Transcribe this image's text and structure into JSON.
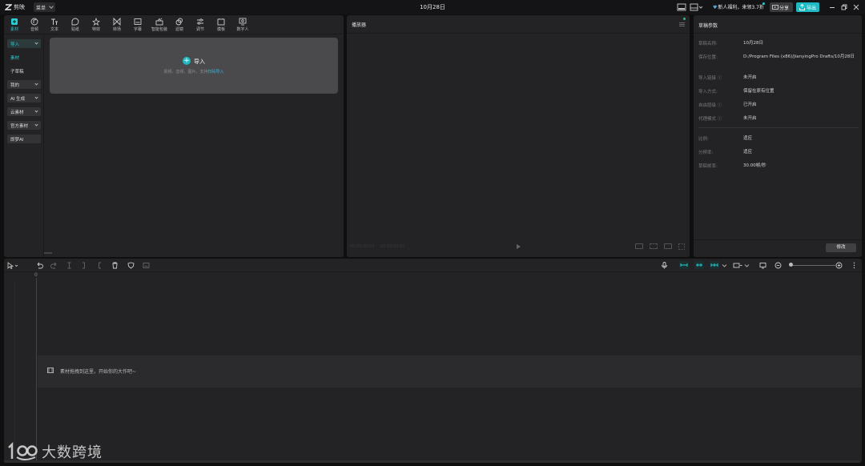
{
  "titlebar": {
    "app_name": "剪映",
    "menu_label": "菜单",
    "project_title": "10月28日",
    "promo": "新人福利，来领3.7折",
    "share_label": "分享",
    "export_label": "导出"
  },
  "media_tabs": [
    {
      "label": "素材",
      "icon": "media-icon"
    },
    {
      "label": "音频",
      "icon": "audio-icon"
    },
    {
      "label": "文本",
      "icon": "text-icon"
    },
    {
      "label": "贴纸",
      "icon": "sticker-icon"
    },
    {
      "label": "特效",
      "icon": "effects-icon"
    },
    {
      "label": "转场",
      "icon": "transition-icon"
    },
    {
      "label": "字幕",
      "icon": "subtitle-icon"
    },
    {
      "label": "智能包装",
      "icon": "smart-package-icon"
    },
    {
      "label": "滤镜",
      "icon": "filter-icon"
    },
    {
      "label": "调节",
      "icon": "adjust-icon"
    },
    {
      "label": "模板",
      "icon": "template-icon"
    },
    {
      "label": "数字人",
      "icon": "digital-human-icon"
    }
  ],
  "media_sidebar": {
    "import": "导入",
    "material": "素材",
    "subproject": "子草稿",
    "mine": "我的",
    "ai_generate": "AI 生成",
    "cloud": "云素材",
    "official": "官方素材",
    "jimeng": "即梦AI"
  },
  "import_area": {
    "label": "导入",
    "hint_prefix": "视频、音频、图片，支持",
    "hint_link": "扫码导入"
  },
  "player": {
    "title": "播放器",
    "time_current": "00:00:00:00",
    "time_total": "00:00:00:00"
  },
  "params": {
    "title": "草稿参数",
    "rows_top": [
      {
        "key": "草稿名称:",
        "value": "10月28日"
      },
      {
        "key": "保存位置:",
        "value": "D:/Program Files (x86)/JianyingPro Drafts/10月28日"
      },
      {
        "key": "导入链接 ⓘ",
        "value": "未开启"
      },
      {
        "key": "导入方式:",
        "value": "保留在原有位置"
      },
      {
        "key": "自由层级 ⓘ",
        "value": "已开启"
      },
      {
        "key": "代理模式 ⓘ",
        "value": "未开启"
      }
    ],
    "rows_bottom": [
      {
        "key": "比例:",
        "value": "适应"
      },
      {
        "key": "分辨率:",
        "value": "适应"
      },
      {
        "key": "草稿帧率:",
        "value": "30.00帧/秒"
      }
    ],
    "modify_label": "修改"
  },
  "timeline": {
    "ruler_zero": "0",
    "track_hint": "素材拖拽到这里，开始你的大作吧~"
  },
  "watermark": {
    "text": "大数跨境"
  },
  "colors": {
    "accent": "#1fb9c4",
    "panel": "#232325",
    "background": "#0f0f10"
  }
}
